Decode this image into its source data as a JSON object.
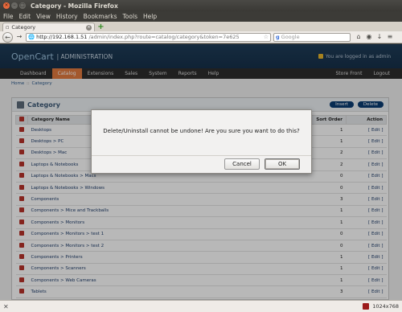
{
  "window": {
    "title": "Category - Mozilla Firefox"
  },
  "menu": [
    "File",
    "Edit",
    "View",
    "History",
    "Bookmarks",
    "Tools",
    "Help"
  ],
  "tab": {
    "label": "Category"
  },
  "nav": {
    "url_host": "http://192.168.1.51",
    "url_path": "/admin/index.php?route=catalog/category&token=7e625",
    "search_placeholder": "Google"
  },
  "header": {
    "logo": "OpenCart",
    "admin": "| ADMINISTRATION",
    "logged_in": "You are logged in as admin"
  },
  "oc_menu": {
    "left": [
      "Dashboard",
      "Catalog",
      "Extensions",
      "Sales",
      "System",
      "Reports",
      "Help"
    ],
    "right": [
      "Store Front",
      "Logout"
    ]
  },
  "breadcrumb": {
    "home": "Home",
    "sep": "::",
    "current": "Category"
  },
  "box": {
    "title": "Category",
    "insert": "Insert",
    "delete": "Delete",
    "columns": {
      "name": "Category Name",
      "order": "Sort Order",
      "action": "Action"
    },
    "rows": [
      {
        "name": "Desktops",
        "order": "1",
        "action": "[ Edit ]"
      },
      {
        "name": "Desktops > PC",
        "order": "1",
        "action": "[ Edit ]"
      },
      {
        "name": "Desktops > Mac",
        "order": "2",
        "action": "[ Edit ]"
      },
      {
        "name": "Laptops & Notebooks",
        "order": "2",
        "action": "[ Edit ]"
      },
      {
        "name": "Laptops & Notebooks > Macs",
        "order": "0",
        "action": "[ Edit ]"
      },
      {
        "name": "Laptops & Notebooks > Windows",
        "order": "0",
        "action": "[ Edit ]"
      },
      {
        "name": "Components",
        "order": "3",
        "action": "[ Edit ]"
      },
      {
        "name": "Components > Mice and Trackballs",
        "order": "1",
        "action": "[ Edit ]"
      },
      {
        "name": "Components > Monitors",
        "order": "1",
        "action": "[ Edit ]"
      },
      {
        "name": "Components > Monitors > test 1",
        "order": "0",
        "action": "[ Edit ]"
      },
      {
        "name": "Components > Monitors > test 2",
        "order": "0",
        "action": "[ Edit ]"
      },
      {
        "name": "Components > Printers",
        "order": "1",
        "action": "[ Edit ]"
      },
      {
        "name": "Components > Scanners",
        "order": "1",
        "action": "[ Edit ]"
      },
      {
        "name": "Components > Web Cameras",
        "order": "1",
        "action": "[ Edit ]"
      },
      {
        "name": "Tablets",
        "order": "3",
        "action": "[ Edit ]"
      }
    ]
  },
  "dialog": {
    "message": "Delete/Uninstall cannot be undone! Are you sure you want to do this?",
    "cancel": "Cancel",
    "ok": "OK"
  },
  "status": {
    "resolution": "1024x768"
  }
}
